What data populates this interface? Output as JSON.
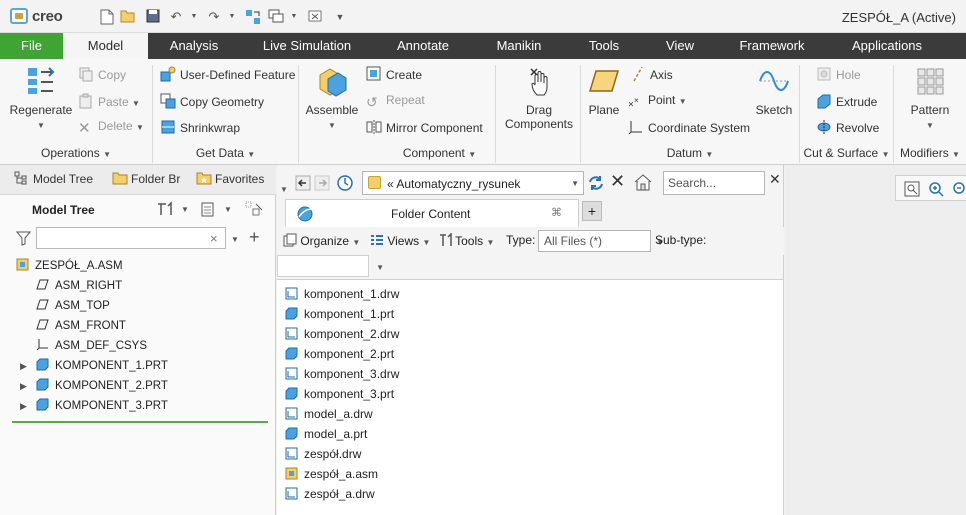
{
  "app": {
    "logo": "creo",
    "window_title": "ZESPÓŁ_A (Active)"
  },
  "quick_access": [
    "new-icon",
    "open-icon",
    "save-icon",
    "undo-icon",
    "redo-icon",
    "regenerate-icon",
    "windows-icon",
    "close-icon",
    "customize-icon"
  ],
  "tabs": [
    "File",
    "Model",
    "Analysis",
    "Live Simulation",
    "Annotate",
    "Manikin",
    "Tools",
    "View",
    "Framework",
    "Applications"
  ],
  "ribbon": {
    "operations": {
      "label": "Operations",
      "regenerate": "Regenerate",
      "copy": "Copy",
      "paste": "Paste",
      "delete": "Delete"
    },
    "get_data": {
      "label": "Get Data",
      "udf": "User-Defined Feature",
      "copy_geometry": "Copy Geometry",
      "shrinkwrap": "Shrinkwrap"
    },
    "component": {
      "label": "Component",
      "assemble": "Assemble",
      "create": "Create",
      "repeat": "Repeat",
      "mirror": "Mirror Component",
      "drag1": "Drag",
      "drag2": "Components"
    },
    "datum": {
      "label": "Datum",
      "plane": "Plane",
      "axis": "Axis",
      "point": "Point",
      "csys": "Coordinate System",
      "sketch": "Sketch"
    },
    "cut_surface": {
      "label": "Cut & Surface",
      "hole": "Hole",
      "extrude": "Extrude",
      "revolve": "Revolve"
    },
    "modifiers": {
      "label": "Modifiers",
      "pattern": "Pattern"
    }
  },
  "nav_tabs": [
    "Model Tree",
    "Folder Br",
    "Favorites"
  ],
  "model_tree": {
    "title": "Model Tree",
    "filter_value": "",
    "items": [
      {
        "label": "ZESPÓŁ_A.ASM",
        "icon": "assembly-icon",
        "level": 0
      },
      {
        "label": "ASM_RIGHT",
        "icon": "datum-plane-icon",
        "level": 1
      },
      {
        "label": "ASM_TOP",
        "icon": "datum-plane-icon",
        "level": 1
      },
      {
        "label": "ASM_FRONT",
        "icon": "datum-plane-icon",
        "level": 1
      },
      {
        "label": "ASM_DEF_CSYS",
        "icon": "csys-icon",
        "level": 1
      },
      {
        "label": "KOMPONENT_1.PRT",
        "icon": "part-icon",
        "level": 1,
        "expandable": true
      },
      {
        "label": "KOMPONENT_2.PRT",
        "icon": "part-icon",
        "level": 1,
        "expandable": true
      },
      {
        "label": "KOMPONENT_3.PRT",
        "icon": "part-icon",
        "level": 1,
        "expandable": true
      }
    ]
  },
  "browser": {
    "address": "Automatyczny_rysunek",
    "address_prefix": "«",
    "search_placeholder": "Search...",
    "tab_label": "Folder Content",
    "toolbar": {
      "organize": "Organize",
      "views": "Views",
      "tools": "Tools",
      "type_label": "Type:",
      "type_value": "All Files (*)",
      "subtype_label": "Sub-type:"
    },
    "files": [
      {
        "name": "komponent_1.drw",
        "icon": "drawing-icon"
      },
      {
        "name": "komponent_1.prt",
        "icon": "part-icon"
      },
      {
        "name": "komponent_2.drw",
        "icon": "drawing-icon"
      },
      {
        "name": "komponent_2.prt",
        "icon": "part-icon"
      },
      {
        "name": "komponent_3.drw",
        "icon": "drawing-icon"
      },
      {
        "name": "komponent_3.prt",
        "icon": "part-icon"
      },
      {
        "name": "model_a.drw",
        "icon": "drawing-icon"
      },
      {
        "name": "model_a.prt",
        "icon": "part-icon"
      },
      {
        "name": "zespół.drw",
        "icon": "drawing-icon"
      },
      {
        "name": "zespół_a.asm",
        "icon": "assembly-icon"
      },
      {
        "name": "zespół_a.drw",
        "icon": "drawing-icon"
      }
    ]
  },
  "colors": {
    "file_tab": "#3fa433",
    "tab_bar": "#3b3b3b",
    "accent_green": "#53b03f",
    "part_blue": "#4aa3df"
  }
}
